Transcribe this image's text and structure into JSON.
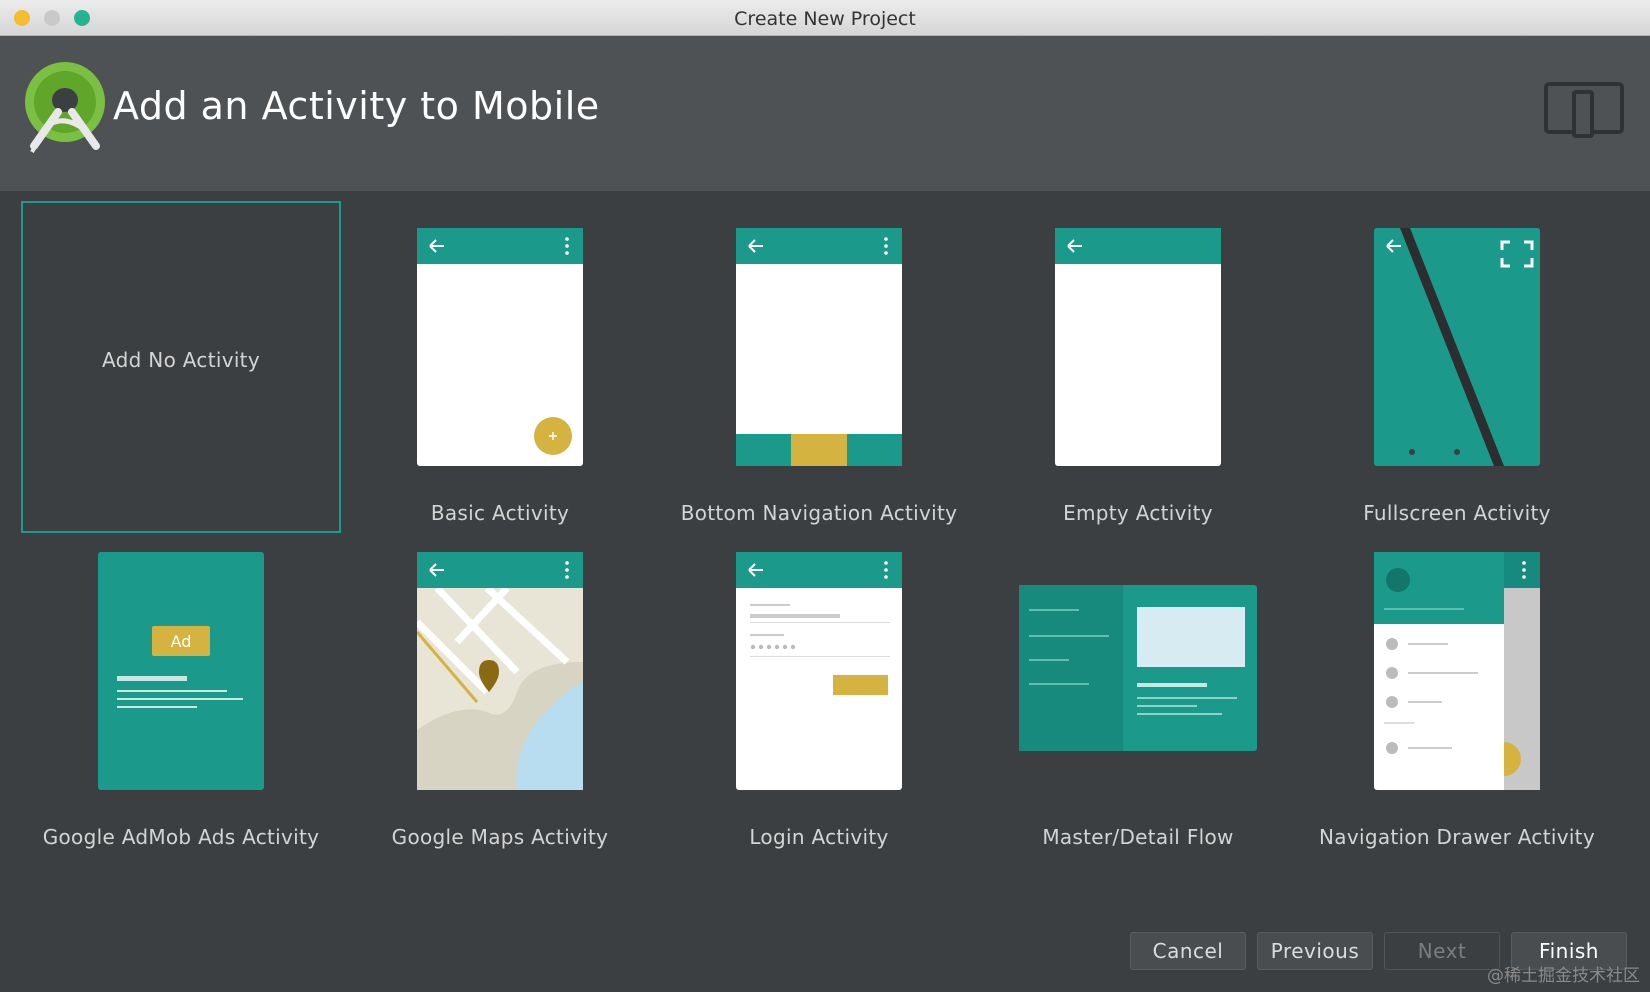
{
  "window": {
    "title": "Create New Project"
  },
  "header": {
    "heading": "Add an Activity to Mobile"
  },
  "templates": [
    {
      "label": "Add No Activity",
      "selected": true
    },
    {
      "label": "Basic Activity"
    },
    {
      "label": "Bottom Navigation Activity"
    },
    {
      "label": "Empty Activity"
    },
    {
      "label": "Fullscreen Activity"
    },
    {
      "label": "Google AdMob Ads Activity",
      "badge": "Ad"
    },
    {
      "label": "Google Maps Activity"
    },
    {
      "label": "Login Activity"
    },
    {
      "label": "Master/Detail Flow"
    },
    {
      "label": "Navigation Drawer Activity"
    }
  ],
  "buttons": {
    "cancel": "Cancel",
    "previous": "Previous",
    "next": "Next",
    "finish": "Finish"
  },
  "watermark": "@稀土掘金技术社区",
  "colors": {
    "teal": "#1b9a8c",
    "accent_yellow": "#d4b340",
    "background": "#3c3f41",
    "header": "#4e5254"
  }
}
